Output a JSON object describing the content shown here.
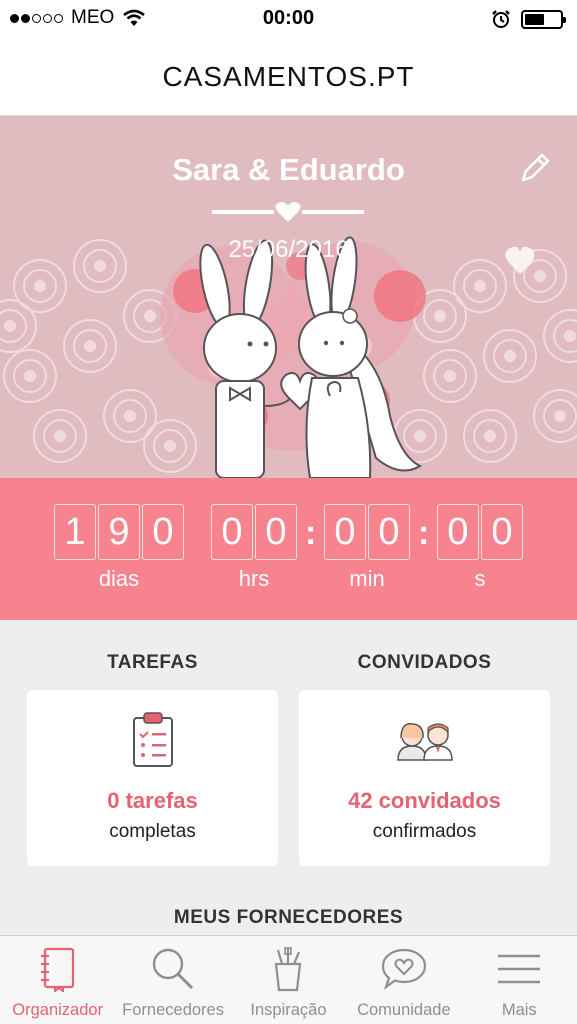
{
  "status_bar": {
    "carrier": "MEO",
    "time": "00:00"
  },
  "header": {
    "title": "CASAMENTOS.PT"
  },
  "hero": {
    "couple_names": "Sara & Eduardo",
    "date": "25/06/2016"
  },
  "countdown": {
    "days_digits": [
      "1",
      "9",
      "0"
    ],
    "hours_digits": [
      "0",
      "0"
    ],
    "minutes_digits": [
      "0",
      "0"
    ],
    "seconds_digits": [
      "0",
      "0"
    ],
    "days_label": "dias",
    "hours_label": "hrs",
    "minutes_label": "min",
    "seconds_label": "s"
  },
  "tasks": {
    "title": "TAREFAS",
    "count_text": "0 tarefas",
    "sub_text": "completas"
  },
  "guests": {
    "title": "CONVIDADOS",
    "count_text": "42 convidados",
    "sub_text": "confirmados"
  },
  "vendors": {
    "title": "MEUS FORNECEDORES"
  },
  "tabs": [
    {
      "label": "Organizador",
      "icon": "notebook-icon",
      "active": true
    },
    {
      "label": "Fornecedores",
      "icon": "search-icon",
      "active": false
    },
    {
      "label": "Inspiração",
      "icon": "brush-cup-icon",
      "active": false
    },
    {
      "label": "Comunidade",
      "icon": "chat-heart-icon",
      "active": false
    },
    {
      "label": "Mais",
      "icon": "menu-icon",
      "active": false
    }
  ],
  "colors": {
    "accent": "#f6838d",
    "accent_text": "#e46370",
    "hero_bg": "#e0bcc1"
  }
}
